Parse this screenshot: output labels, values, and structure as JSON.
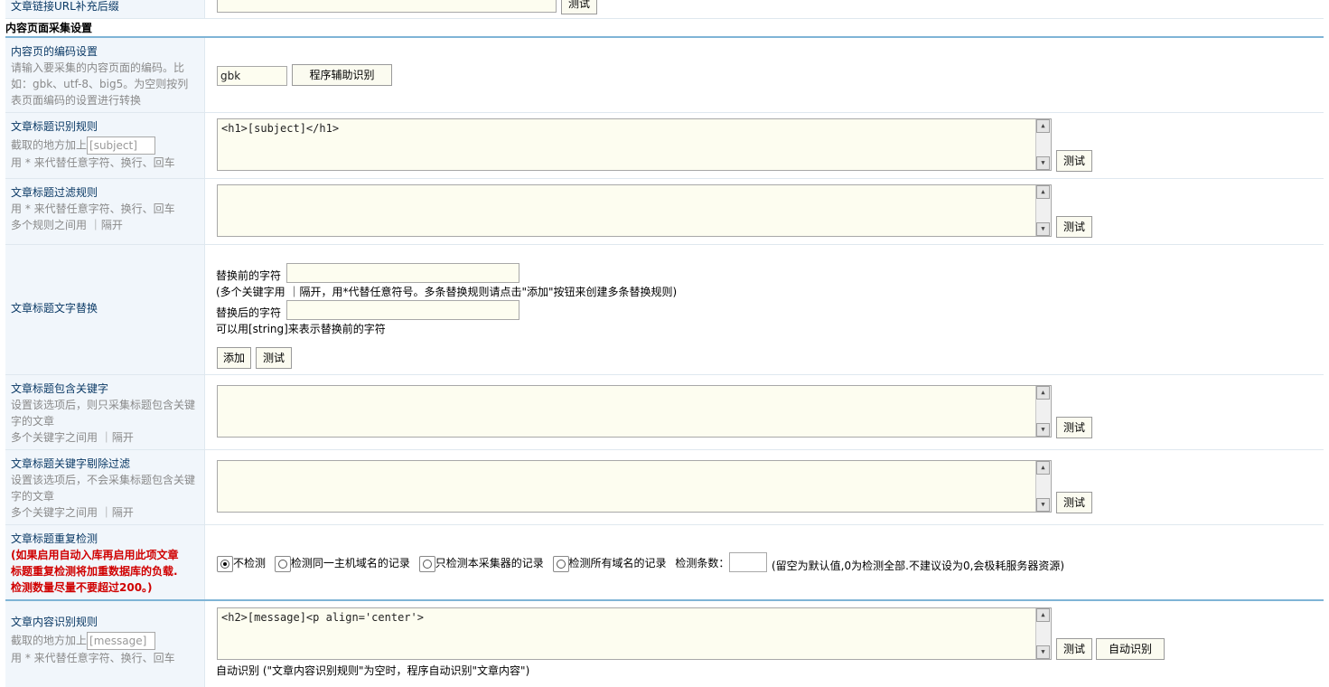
{
  "top_row": {
    "label": "文章链接URL补充后缀",
    "test_button": "测试"
  },
  "section_title": "内容页面采集设置",
  "encoding": {
    "title": "内容页的编码设置",
    "desc": [
      "请输入要采集的内容页面的编码。比",
      "如：gbk、utf-8、big5。为空则按列",
      "表页面编码的设置进行转换"
    ],
    "value": "gbk",
    "button": "程序辅助识别"
  },
  "title_rule": {
    "title": "文章标题识别规则",
    "prefix_text": "截取的地方加上",
    "placeholder": "[subject]",
    "desc": "用 * 来代替任意字符、换行、回车",
    "value": "<h1>[subject]</h1>",
    "test_button": "测试"
  },
  "title_filter": {
    "title": "文章标题过滤规则",
    "desc": [
      "用 * 来代替任意字符、换行、回车",
      "多个规则之间用 ｜隔开"
    ],
    "value": "",
    "test_button": "测试"
  },
  "title_replace": {
    "title": "文章标题文字替换",
    "before_label": "替换前的字符",
    "before_hint": "(多个关键字用 ｜隔开，用*代替任意符号。多条替换规则请点击\"添加\"按钮来创建多条替换规则)",
    "after_label": "替换后的字符",
    "after_hint": "可以用[string]来表示替换前的字符",
    "add_button": "添加",
    "test_button": "测试"
  },
  "title_include": {
    "title": "文章标题包含关键字",
    "desc": [
      "设置该选项后，则只采集标题包含关键",
      "字的文章",
      "多个关键字之间用 ｜隔开"
    ],
    "value": "",
    "test_button": "测试"
  },
  "title_exclude": {
    "title": "文章标题关键字剔除过滤",
    "desc": [
      "设置该选项后，不会采集标题包含关键",
      "字的文章",
      "多个关键字之间用 ｜隔开"
    ],
    "value": "",
    "test_button": "测试"
  },
  "dup_check": {
    "title": "文章标题重复检测",
    "warning": [
      "(如果启用自动入库再启用此项文章",
      "标题重复检测将加重数据库的负载.",
      "检测数量尽量不要超过200。)"
    ],
    "options": [
      "不检测",
      "检测同一主机域名的记录",
      "只检测本采集器的记录",
      "检测所有域名的记录"
    ],
    "selected": "不检测",
    "count_label": "检测条数：",
    "count_value": "",
    "note": "(留空为默认值,0为检测全部.不建议设为0,会极耗服务器资源)"
  },
  "content_rule": {
    "title": "文章内容识别规则",
    "prefix_text": "截取的地方加上",
    "placeholder": "[message]",
    "desc": "用 * 来代替任意字符、换行、回车",
    "value": "<h2>[message]<p align='center'>",
    "test_button": "测试",
    "auto_button": "自动识别",
    "footer": "自动识别 (\"文章内容识别规则\"为空时，程序自动识别\"文章内容\")"
  }
}
